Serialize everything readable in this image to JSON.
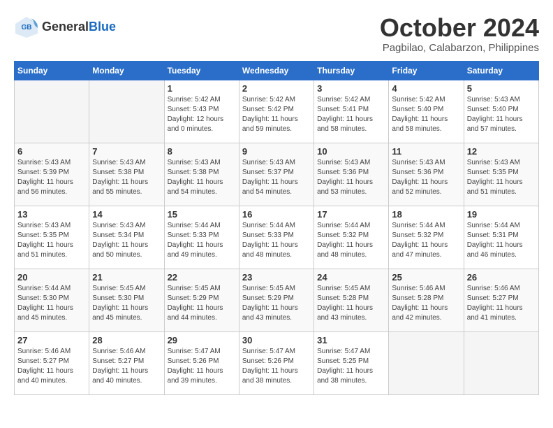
{
  "logo": {
    "text1": "General",
    "text2": "Blue"
  },
  "title": {
    "month": "October 2024",
    "location": "Pagbilao, Calabarzon, Philippines"
  },
  "headers": [
    "Sunday",
    "Monday",
    "Tuesday",
    "Wednesday",
    "Thursday",
    "Friday",
    "Saturday"
  ],
  "weeks": [
    [
      {
        "day": "",
        "info": ""
      },
      {
        "day": "",
        "info": ""
      },
      {
        "day": "1",
        "info": "Sunrise: 5:42 AM\nSunset: 5:43 PM\nDaylight: 12 hours\nand 0 minutes."
      },
      {
        "day": "2",
        "info": "Sunrise: 5:42 AM\nSunset: 5:42 PM\nDaylight: 11 hours\nand 59 minutes."
      },
      {
        "day": "3",
        "info": "Sunrise: 5:42 AM\nSunset: 5:41 PM\nDaylight: 11 hours\nand 58 minutes."
      },
      {
        "day": "4",
        "info": "Sunrise: 5:42 AM\nSunset: 5:40 PM\nDaylight: 11 hours\nand 58 minutes."
      },
      {
        "day": "5",
        "info": "Sunrise: 5:43 AM\nSunset: 5:40 PM\nDaylight: 11 hours\nand 57 minutes."
      }
    ],
    [
      {
        "day": "6",
        "info": "Sunrise: 5:43 AM\nSunset: 5:39 PM\nDaylight: 11 hours\nand 56 minutes."
      },
      {
        "day": "7",
        "info": "Sunrise: 5:43 AM\nSunset: 5:38 PM\nDaylight: 11 hours\nand 55 minutes."
      },
      {
        "day": "8",
        "info": "Sunrise: 5:43 AM\nSunset: 5:38 PM\nDaylight: 11 hours\nand 54 minutes."
      },
      {
        "day": "9",
        "info": "Sunrise: 5:43 AM\nSunset: 5:37 PM\nDaylight: 11 hours\nand 54 minutes."
      },
      {
        "day": "10",
        "info": "Sunrise: 5:43 AM\nSunset: 5:36 PM\nDaylight: 11 hours\nand 53 minutes."
      },
      {
        "day": "11",
        "info": "Sunrise: 5:43 AM\nSunset: 5:36 PM\nDaylight: 11 hours\nand 52 minutes."
      },
      {
        "day": "12",
        "info": "Sunrise: 5:43 AM\nSunset: 5:35 PM\nDaylight: 11 hours\nand 51 minutes."
      }
    ],
    [
      {
        "day": "13",
        "info": "Sunrise: 5:43 AM\nSunset: 5:35 PM\nDaylight: 11 hours\nand 51 minutes."
      },
      {
        "day": "14",
        "info": "Sunrise: 5:43 AM\nSunset: 5:34 PM\nDaylight: 11 hours\nand 50 minutes."
      },
      {
        "day": "15",
        "info": "Sunrise: 5:44 AM\nSunset: 5:33 PM\nDaylight: 11 hours\nand 49 minutes."
      },
      {
        "day": "16",
        "info": "Sunrise: 5:44 AM\nSunset: 5:33 PM\nDaylight: 11 hours\nand 48 minutes."
      },
      {
        "day": "17",
        "info": "Sunrise: 5:44 AM\nSunset: 5:32 PM\nDaylight: 11 hours\nand 48 minutes."
      },
      {
        "day": "18",
        "info": "Sunrise: 5:44 AM\nSunset: 5:32 PM\nDaylight: 11 hours\nand 47 minutes."
      },
      {
        "day": "19",
        "info": "Sunrise: 5:44 AM\nSunset: 5:31 PM\nDaylight: 11 hours\nand 46 minutes."
      }
    ],
    [
      {
        "day": "20",
        "info": "Sunrise: 5:44 AM\nSunset: 5:30 PM\nDaylight: 11 hours\nand 45 minutes."
      },
      {
        "day": "21",
        "info": "Sunrise: 5:45 AM\nSunset: 5:30 PM\nDaylight: 11 hours\nand 45 minutes."
      },
      {
        "day": "22",
        "info": "Sunrise: 5:45 AM\nSunset: 5:29 PM\nDaylight: 11 hours\nand 44 minutes."
      },
      {
        "day": "23",
        "info": "Sunrise: 5:45 AM\nSunset: 5:29 PM\nDaylight: 11 hours\nand 43 minutes."
      },
      {
        "day": "24",
        "info": "Sunrise: 5:45 AM\nSunset: 5:28 PM\nDaylight: 11 hours\nand 43 minutes."
      },
      {
        "day": "25",
        "info": "Sunrise: 5:46 AM\nSunset: 5:28 PM\nDaylight: 11 hours\nand 42 minutes."
      },
      {
        "day": "26",
        "info": "Sunrise: 5:46 AM\nSunset: 5:27 PM\nDaylight: 11 hours\nand 41 minutes."
      }
    ],
    [
      {
        "day": "27",
        "info": "Sunrise: 5:46 AM\nSunset: 5:27 PM\nDaylight: 11 hours\nand 40 minutes."
      },
      {
        "day": "28",
        "info": "Sunrise: 5:46 AM\nSunset: 5:27 PM\nDaylight: 11 hours\nand 40 minutes."
      },
      {
        "day": "29",
        "info": "Sunrise: 5:47 AM\nSunset: 5:26 PM\nDaylight: 11 hours\nand 39 minutes."
      },
      {
        "day": "30",
        "info": "Sunrise: 5:47 AM\nSunset: 5:26 PM\nDaylight: 11 hours\nand 38 minutes."
      },
      {
        "day": "31",
        "info": "Sunrise: 5:47 AM\nSunset: 5:25 PM\nDaylight: 11 hours\nand 38 minutes."
      },
      {
        "day": "",
        "info": ""
      },
      {
        "day": "",
        "info": ""
      }
    ]
  ]
}
